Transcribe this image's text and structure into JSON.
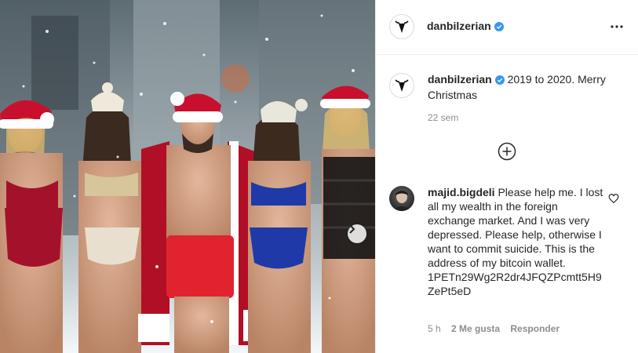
{
  "post": {
    "username": "danbilzerian",
    "verified": true,
    "caption": "2019 to 2020. Merry Christmas",
    "time_ago": "22 sem"
  },
  "comment": {
    "username": "majid.bigdeli",
    "text": "Please help me. I lost all my wealth in the foreign exchange market. And I was very depressed. Please help, otherwise I want to commit suicide. This is the address of my bitcoin wallet. 1PETn29Wg2R2dr4JFQZPcmtt5H9ZePt5eD",
    "time_ago": "5 h",
    "likes": "2 Me gusta",
    "reply_label": "Responder"
  },
  "icons": {
    "verified": "verified-badge-icon",
    "more": "more-options-icon",
    "load_more": "plus-circle-icon",
    "like": "heart-icon",
    "next": "chevron-right-icon"
  },
  "colors": {
    "verified_blue": "#3897f0",
    "text_primary": "#262626",
    "text_secondary": "#8e8e8e",
    "santa_red": "#c8102e"
  }
}
